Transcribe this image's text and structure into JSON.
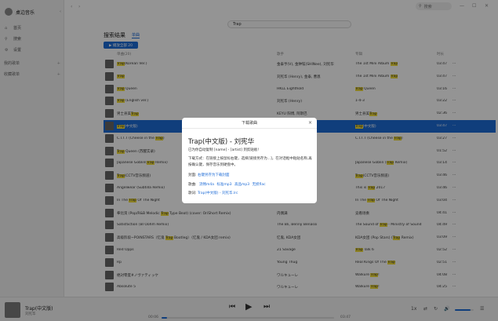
{
  "sidebar": {
    "title": "桌边音乐",
    "items": [
      {
        "icon": "home-icon",
        "glyph": "⌂",
        "label": "首页"
      },
      {
        "icon": "search-icon",
        "glyph": "⚲",
        "label": "搜索"
      },
      {
        "icon": "settings-icon",
        "glyph": "⚙",
        "label": "设置"
      }
    ],
    "sections": [
      {
        "label": "我的歌单",
        "plus": "+"
      },
      {
        "label": "收藏歌单",
        "plus": "+"
      }
    ]
  },
  "topbar": {
    "back": "‹",
    "forward": "›",
    "search_placeholder": "搜索",
    "minimize": "—",
    "maximize": "☐",
    "close": "✕"
  },
  "search": {
    "query": "Trap"
  },
  "results": {
    "title": "搜索结果",
    "tab": "单曲",
    "play_all": "▶ 播放全部 20",
    "headers": {
      "title": "单曲(20)",
      "artist": "歌手",
      "album": "专辑",
      "duration": "时长"
    },
    "rows": [
      {
        "title": [
          {
            "t": "Trap",
            "h": true
          },
          {
            "t": "(Korean Ver.)"
          }
        ],
        "artist": "金泰亨(V), 金钟铉(SHINee), 刘宪华",
        "album": [
          {
            "t": "The 1st Mini Album "
          },
          {
            "t": "Trap",
            "h": true
          }
        ],
        "duration": "03:47",
        "selected": false
      },
      {
        "title": [
          {
            "t": "Trap",
            "h": true
          }
        ],
        "artist": "刘宪华 (Henry), 金泰, 曹恩",
        "album": [
          {
            "t": "The 1st Mini Album "
          },
          {
            "t": "Trap",
            "h": true
          }
        ],
        "duration": "03:47",
        "selected": false
      },
      {
        "title": [
          {
            "t": "Trap",
            "h": true
          },
          {
            "t": " Queen"
          }
        ],
        "artist": "HKLL Eighthold",
        "album": [
          {
            "t": "Trap",
            "h": true
          },
          {
            "t": " Queen"
          }
        ],
        "duration": "03:16",
        "selected": false
      },
      {
        "title": [
          {
            "t": "Trap",
            "h": true
          },
          {
            "t": " (English ver.)"
          }
        ],
        "artist": "刘宪华 (Henry)",
        "album": [
          {
            "t": "1-4-3"
          }
        ],
        "duration": "03:22",
        "selected": false
      },
      {
        "title": [
          {
            "t": "男士县美"
          },
          {
            "t": "Trap",
            "h": true
          }
        ],
        "artist": "KEYU 阳博, 阿斯巴",
        "album": [
          {
            "t": "男士县美"
          },
          {
            "t": "Trap",
            "h": true
          }
        ],
        "duration": "02:36",
        "selected": false
      },
      {
        "title": [
          {
            "t": "Trap",
            "h": true
          },
          {
            "t": "(中文版)"
          }
        ],
        "artist": "刘宪华",
        "album": [
          {
            "t": "Trap",
            "h": true
          },
          {
            "t": "(中文版)"
          }
        ],
        "duration": "03:47",
        "selected": true
      },
      {
        "title": [
          {
            "t": "C.I.T.T (Cheese in the "
          },
          {
            "t": "Trap",
            "h": true
          },
          {
            "t": ")"
          }
        ],
        "artist": "Xotime",
        "album": [
          {
            "t": "C.I.T.T (Cheese in the "
          },
          {
            "t": "Trap",
            "h": true
          },
          {
            "t": ")"
          }
        ],
        "duration": "03:27",
        "selected": false
      },
      {
        "title": [
          {
            "t": "Trap",
            "h": true
          },
          {
            "t": " Queen (苏醒实录)"
          }
        ],
        "artist": "",
        "album": [],
        "duration": "01:52",
        "selected": false
      },
      {
        "title": [
          {
            "t": "Japanese Goblin("
          },
          {
            "t": "Trap",
            "h": true
          },
          {
            "t": " Remix)"
          }
        ],
        "artist": "",
        "album": [
          {
            "t": "Japanese Goblin ("
          },
          {
            "t": "Trap",
            "h": true
          },
          {
            "t": " Remix)"
          }
        ],
        "duration": "03:14",
        "selected": false
      },
      {
        "title": [
          {
            "t": "Trap",
            "h": true
          },
          {
            "t": "(CCTV音乐频道)"
          }
        ],
        "artist": "",
        "album": [
          {
            "t": "Trap",
            "h": true
          },
          {
            "t": "(CCTV音乐频道)"
          }
        ],
        "duration": "03:46",
        "selected": false
      },
      {
        "title": [
          {
            "t": "Angelwear (Subtilla Remix)"
          }
        ],
        "artist": "",
        "album": [
          {
            "t": "This is "
          },
          {
            "t": "Trap",
            "h": true
          },
          {
            "t": " 2017"
          }
        ],
        "duration": "03:46",
        "selected": false
      },
      {
        "title": [
          {
            "t": "In The "
          },
          {
            "t": "Trap",
            "h": true
          },
          {
            "t": " Of The Night"
          }
        ],
        "artist": "",
        "album": [
          {
            "t": "In The "
          },
          {
            "t": "Trap",
            "h": true
          },
          {
            "t": " Of The Night"
          }
        ],
        "duration": "03:04",
        "selected": false
      },
      {
        "title": [
          {
            "t": "拳比资 (Pop/R&B Melodic "
          },
          {
            "t": "Trap",
            "h": true
          },
          {
            "t": " Type Beat) (cover: OriShort Remix)"
          }
        ],
        "artist": "内偶满",
        "album": [
          {
            "t": "竞看场奏"
          }
        ],
        "duration": "04:41",
        "selected": false
      },
      {
        "title": [
          {
            "t": "Satisfaction (Bl Oohm Remix)"
          }
        ],
        "artist": "The Bli, Benny Benassi",
        "album": [
          {
            "t": "The Sound of "
          },
          {
            "t": "Trap",
            "h": true
          },
          {
            "t": " - Ministry of Sound"
          }
        ],
        "duration": "04:49",
        "selected": false
      },
      {
        "title": [
          {
            "t": "高级阶段~POINSTARS（忆鬼 "
          },
          {
            "t": "Trap",
            "h": true
          },
          {
            "t": " Bootleg）（忆鬼 / KDA女团 remix)"
          }
        ],
        "artist": "忆鬼, KDA女团",
        "album": [
          {
            "t": "KDA女团 (Pop Stars) ("
          },
          {
            "t": "Trap",
            "h": true
          },
          {
            "t": " Remix)"
          }
        ],
        "duration": "03:09",
        "selected": false
      },
      {
        "title": [
          {
            "t": "Red Opps"
          }
        ],
        "artist": "21 Savage",
        "album": [
          {
            "t": "Trap",
            "h": true
          },
          {
            "t": " Talk 6"
          }
        ],
        "duration": "02:52",
        "selected": false
      },
      {
        "title": [
          {
            "t": "Rp"
          }
        ],
        "artist": "Young Thug",
        "album": [
          {
            "t": "Real Kings Of The "
          },
          {
            "t": "Trap",
            "h": true
          }
        ],
        "duration": "02:51",
        "selected": false
      },
      {
        "title": [
          {
            "t": "絶対零度#ノヴァティッケ"
          }
        ],
        "artist": "ワルキューレ",
        "album": [
          {
            "t": "Walküre "
          },
          {
            "t": "Trap",
            "h": true
          },
          {
            "t": "!"
          }
        ],
        "duration": "04:08",
        "selected": false
      },
      {
        "title": [
          {
            "t": "Absolute 5"
          }
        ],
        "artist": "ワルキューレ",
        "album": [
          {
            "t": "Walküre "
          },
          {
            "t": "Trap",
            "h": true
          },
          {
            "t": "!"
          }
        ],
        "duration": "04:25",
        "selected": false
      }
    ],
    "more_glyph": "···"
  },
  "player": {
    "title": "Trap(中文版)",
    "artist": "刘宪华",
    "current_time": "00:06",
    "total_time": "03:47",
    "progress": 0.03,
    "prev": "⏮",
    "play": "▶",
    "next": "⏭",
    "speed": "1x",
    "shuffle": "⇄",
    "loop": "↻",
    "playlist": "☰",
    "volume_icon": "🔊",
    "volume": 0.85
  },
  "modal": {
    "header": "下载歌曲",
    "close": "×",
    "title": "Trap(中文版) - 刘宪华",
    "copied": "已为你自动复制 [name] - [artist] 到剪贴板!",
    "method": "下载方式：在链接上按鼠标右键，选择[链接另存为...]，在对话框中粘贴名称,再按确认键，保存音乐到硬盘中。",
    "cover_label": "封面:",
    "cover_link": "右键另存为下载封面",
    "song_label": "歌曲:",
    "song_links": [
      "流畅m4a",
      "标准mp3",
      "高品mp3",
      "无损flac"
    ],
    "lyric_label": "歌词:",
    "lyric_link": "Trap(中文版) - 刘宪华.lrc"
  }
}
